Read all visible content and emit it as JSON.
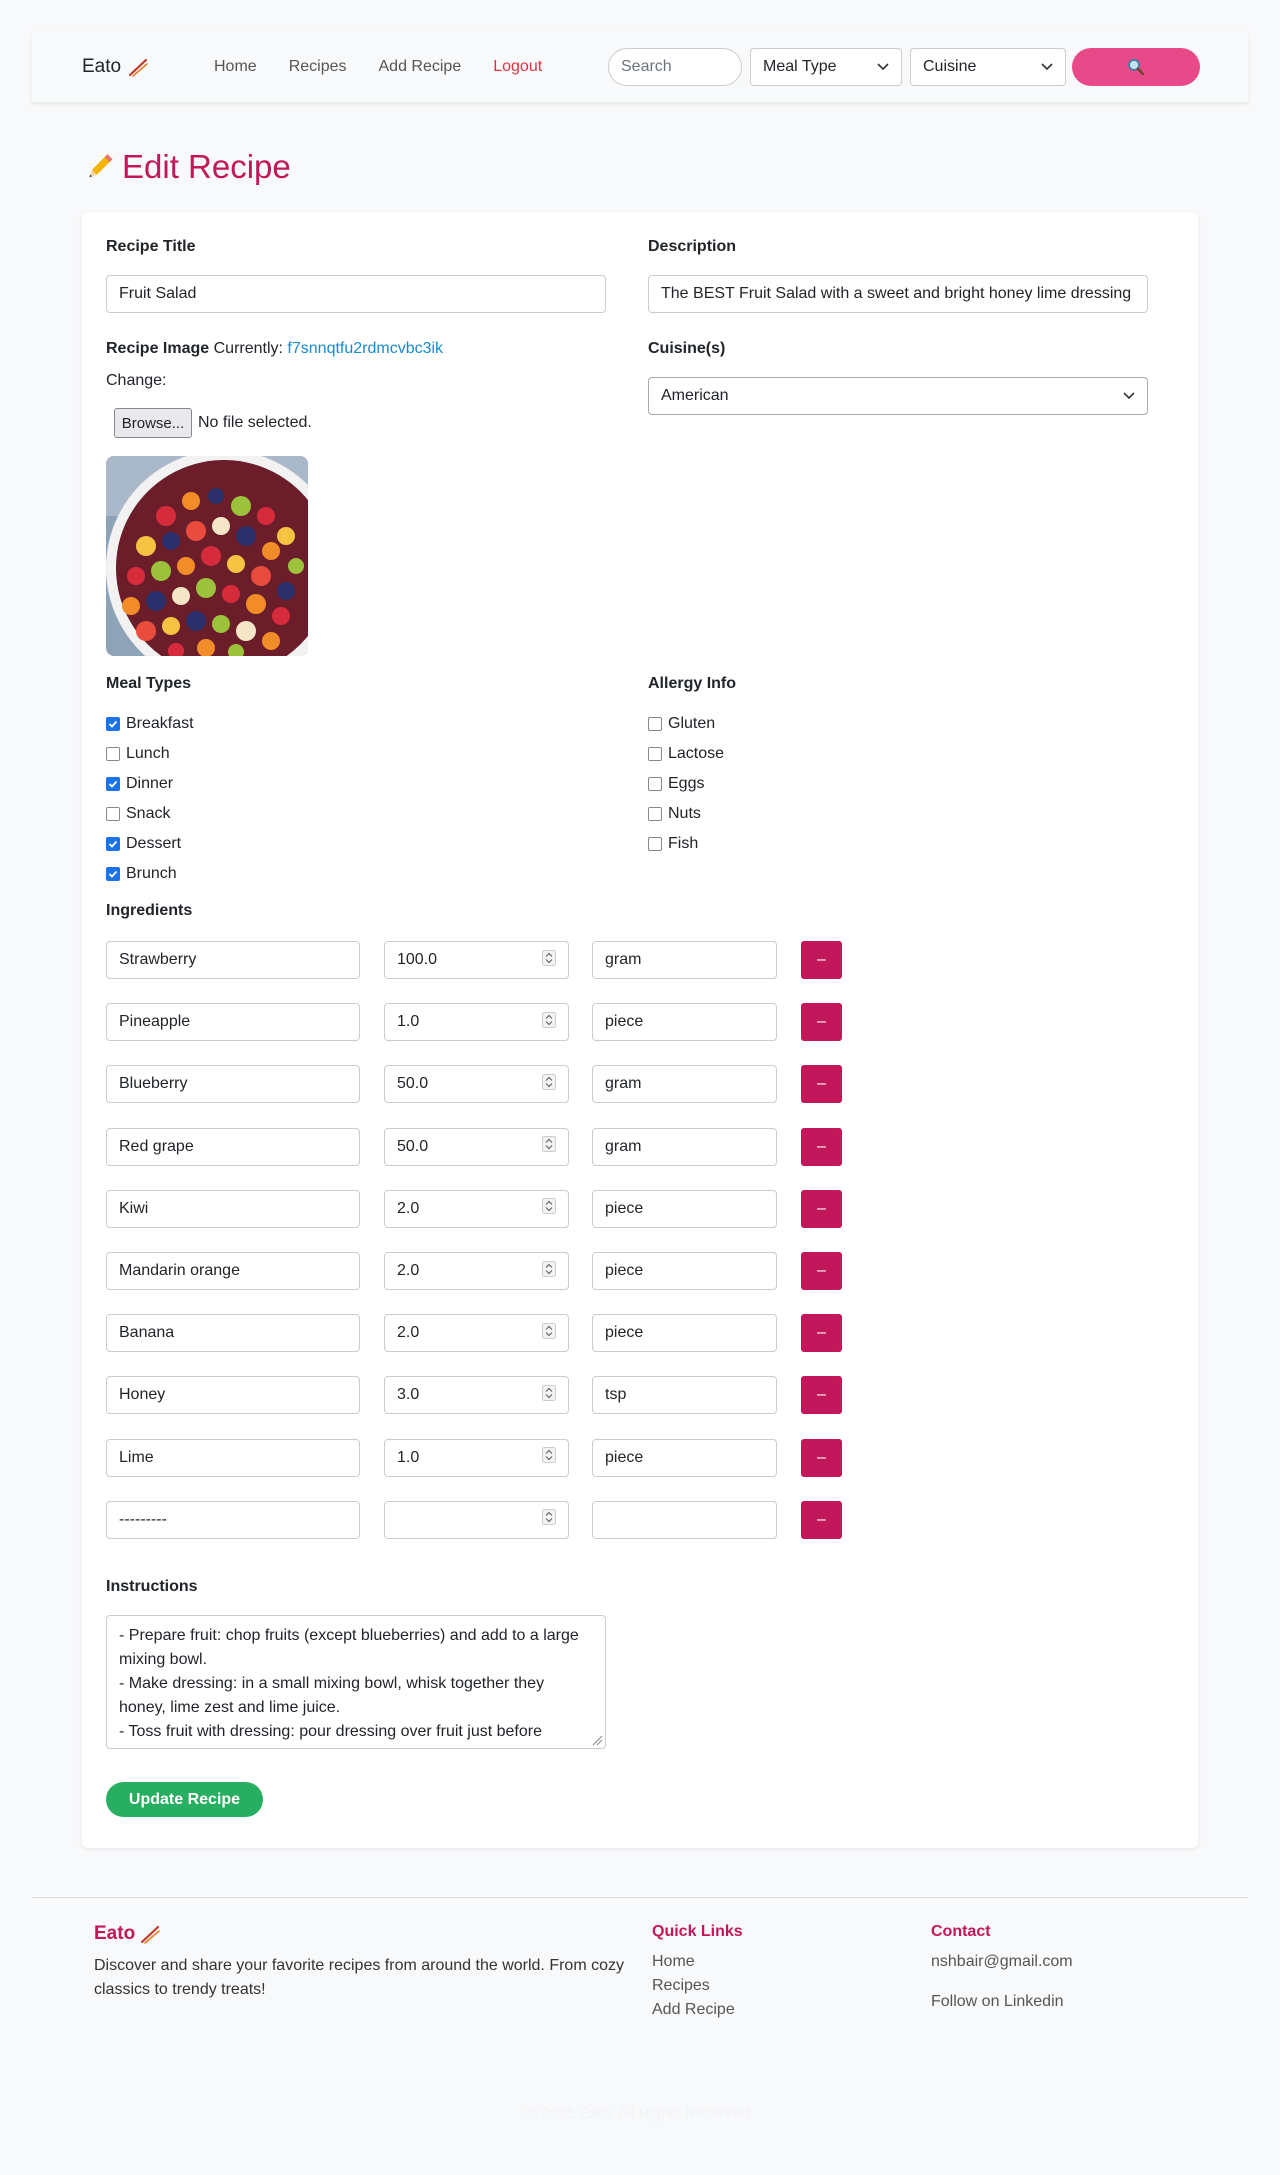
{
  "navbar": {
    "brand": "Eato",
    "links": [
      "Home",
      "Recipes",
      "Add Recipe",
      "Logout"
    ],
    "search_placeholder": "Search",
    "meal_type": "Meal Type",
    "cuisine": "Cuisine",
    "search_button_icon": "magnifier-icon"
  },
  "page": {
    "title": "Edit Recipe"
  },
  "form": {
    "title_label": "Recipe Title",
    "title_value": "Fruit Salad",
    "description_label": "Description",
    "description_value": "The BEST Fruit Salad with a sweet and bright honey lime dressing",
    "image_label": "Recipe Image",
    "image_currently": "Currently:",
    "image_link": "f7snnqtfu2rdmcvbc3ik",
    "image_change": "Change:",
    "browse_label": "Browse...",
    "no_file": "No file selected.",
    "cuisine_label": "Cuisine(s)",
    "cuisine_value": "American",
    "meal_types_label": "Meal Types",
    "meal_types": [
      {
        "label": "Breakfast",
        "checked": true
      },
      {
        "label": "Lunch",
        "checked": false
      },
      {
        "label": "Dinner",
        "checked": true
      },
      {
        "label": "Snack",
        "checked": false
      },
      {
        "label": "Dessert",
        "checked": true
      },
      {
        "label": "Brunch",
        "checked": true
      }
    ],
    "allergy_label": "Allergy Info",
    "allergies": [
      {
        "label": "Gluten",
        "checked": false
      },
      {
        "label": "Lactose",
        "checked": false
      },
      {
        "label": "Eggs",
        "checked": false
      },
      {
        "label": "Nuts",
        "checked": false
      },
      {
        "label": "Fish",
        "checked": false
      }
    ],
    "ingredients_label": "Ingredients",
    "ingredients": [
      {
        "name": "Strawberry",
        "qty": "100.0",
        "unit": "gram"
      },
      {
        "name": "Pineapple",
        "qty": "1.0",
        "unit": "piece"
      },
      {
        "name": "Blueberry",
        "qty": "50.0",
        "unit": "gram"
      },
      {
        "name": "Red grape",
        "qty": "50.0",
        "unit": "gram"
      },
      {
        "name": "Kiwi",
        "qty": "2.0",
        "unit": "piece"
      },
      {
        "name": "Mandarin orange",
        "qty": "2.0",
        "unit": "piece"
      },
      {
        "name": "Banana",
        "qty": "2.0",
        "unit": "piece"
      },
      {
        "name": "Honey",
        "qty": "3.0",
        "unit": "tsp"
      },
      {
        "name": "Lime",
        "qty": "1.0",
        "unit": "piece"
      },
      {
        "name": "---------",
        "qty": "",
        "unit": ""
      }
    ],
    "remove_label": "–",
    "instructions_label": "Instructions",
    "instructions_value": "- Prepare fruit: chop fruits (except blueberries) and add to a large mixing bowl.\n- Make dressing: in a small mixing bowl, whisk together they honey, lime zest and lime juice.\n- Toss fruit with dressing: pour dressing over fruit just before",
    "update_button": "Update Recipe"
  },
  "footer": {
    "brand": "Eato",
    "description": "Discover and share your favorite recipes from around the world. From cozy classics to trendy treats!",
    "quick_links_title": "Quick Links",
    "quick_links": [
      "Home",
      "Recipes",
      "Add Recipe"
    ],
    "contact_title": "Contact",
    "email": "nshbair@gmail.com",
    "linkedin": "Follow on Linkedin",
    "copyright": "© 2025 Eato. All Rights Reserved."
  },
  "colors": {
    "accent": "#c2185b",
    "search_button": "#e84a89",
    "update_button": "#27ae60",
    "logout": "#dc3545",
    "link": "#1a8ad0"
  }
}
